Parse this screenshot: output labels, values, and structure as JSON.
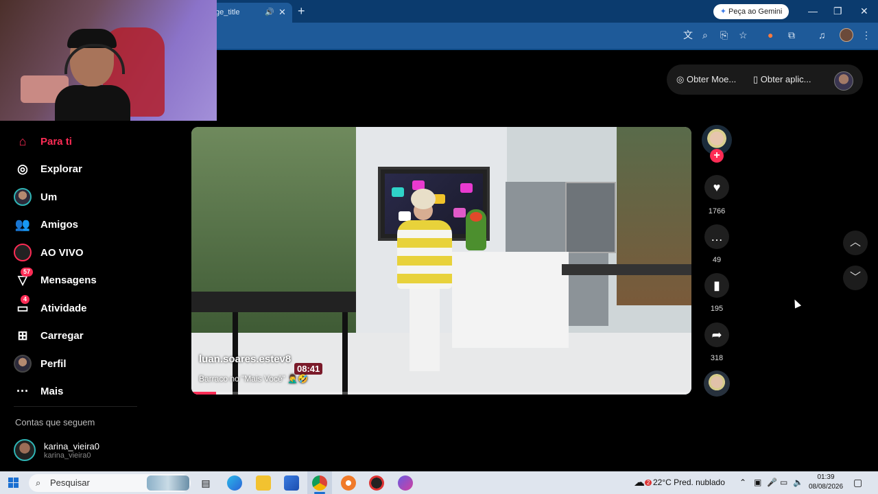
{
  "browser": {
    "tab_title": "ge_title",
    "new_tab_symbol": "+",
    "gemini_button": "Peça ao Gemini",
    "window_controls": [
      "—",
      "❐",
      "✕"
    ],
    "toolbar_icons": [
      "translate-icon",
      "zoom-icon",
      "install-icon",
      "bookmark-star-icon",
      "extension-icon",
      "puzzle-icon",
      "media-icon",
      "profile-icon",
      "menu-icon"
    ]
  },
  "sidebar": {
    "items": [
      {
        "label": "Para ti",
        "icon": "home-icon",
        "active": true
      },
      {
        "label": "Explorar",
        "icon": "compass-icon"
      },
      {
        "label": "Um",
        "icon": "avatar-icon"
      },
      {
        "label": "Amigos",
        "icon": "friends-icon"
      },
      {
        "label": "AO VIVO",
        "icon": "live-icon"
      },
      {
        "label": "Mensagens",
        "icon": "messages-icon",
        "badge": "57"
      },
      {
        "label": "Atividade",
        "icon": "activity-icon",
        "badge": "4"
      },
      {
        "label": "Carregar",
        "icon": "upload-icon"
      },
      {
        "label": "Perfil",
        "icon": "profile-icon"
      },
      {
        "label": "Mais",
        "icon": "more-icon"
      }
    ],
    "following_title": "Contas que seguem",
    "following": [
      {
        "name": "karina_vieira0",
        "handle": "karina_vieira0"
      }
    ]
  },
  "top_pill": {
    "coins": "Obter Moe...",
    "app": "Obter aplic..."
  },
  "video": {
    "username": "luan.soares.estev8",
    "caption": "Barraco no \"Mais Você\" 🤦‍♂️🤣",
    "timestamp": "08:41",
    "progress": 0.05
  },
  "actions": {
    "likes": "1766",
    "comments": "49",
    "saves": "195",
    "shares": "318"
  },
  "taskbar": {
    "search_placeholder": "Pesquisar",
    "weather": "22°C  Pred. nublado",
    "weather_badge": "2",
    "time": "01:39",
    "date": "08/08/2026"
  },
  "colors": {
    "accent": "#fe2c55",
    "chrome_tab_bar": "#0b3b6e",
    "chrome_toolbar": "#1e5a99"
  }
}
